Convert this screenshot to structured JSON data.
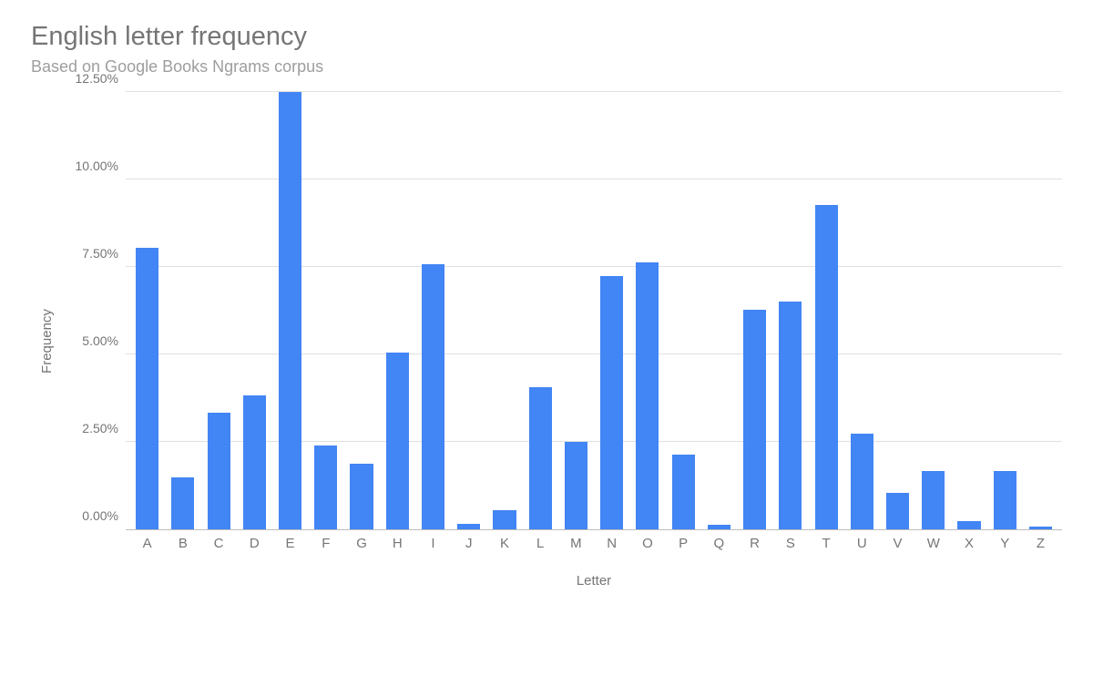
{
  "chart_data": {
    "type": "bar",
    "title": "English letter frequency",
    "subtitle": "Based on Google Books Ngrams corpus",
    "xlabel": "Letter",
    "ylabel": "Frequency",
    "ylim": [
      0,
      12.5
    ],
    "yticks": [
      0.0,
      2.5,
      5.0,
      7.5,
      10.0,
      12.5
    ],
    "ytick_labels": [
      "0.00%",
      "2.50%",
      "5.00%",
      "7.50%",
      "10.00%",
      "12.50%"
    ],
    "categories": [
      "A",
      "B",
      "C",
      "D",
      "E",
      "F",
      "G",
      "H",
      "I",
      "J",
      "K",
      "L",
      "M",
      "N",
      "O",
      "P",
      "Q",
      "R",
      "S",
      "T",
      "U",
      "V",
      "W",
      "X",
      "Y",
      "Z"
    ],
    "values": [
      8.04,
      1.48,
      3.34,
      3.82,
      12.49,
      2.4,
      1.87,
      5.05,
      7.57,
      0.16,
      0.54,
      4.07,
      2.51,
      7.23,
      7.64,
      2.14,
      0.12,
      6.28,
      6.51,
      9.28,
      2.73,
      1.05,
      1.68,
      0.23,
      1.66,
      0.09
    ],
    "bar_color": "#4285f4"
  }
}
